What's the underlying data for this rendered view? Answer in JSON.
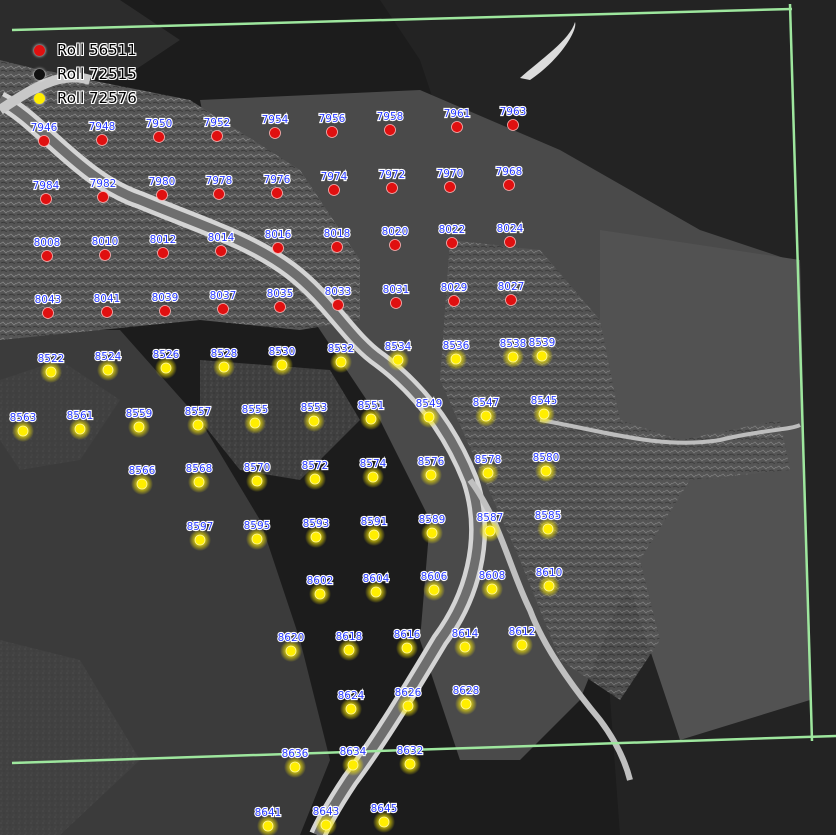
{
  "legend": [
    {
      "label": "Roll 56511",
      "color": "#e01010"
    },
    {
      "label": "Roll 72515",
      "color": "#111111"
    },
    {
      "label": "Roll 72576",
      "color": "#ffee00"
    }
  ],
  "colors": {
    "boundary": "#9ee79e",
    "label_text": "#2a3cff",
    "red_point": "#e01010",
    "yellow_point": "#ffee00"
  },
  "points": {
    "red": [
      "7946",
      "7948",
      "7950",
      "7952",
      "7954",
      "7956",
      "7958",
      "7961",
      "7963",
      "7984",
      "7982",
      "7980",
      "7978",
      "7976",
      "7974",
      "7972",
      "7970",
      "7968",
      "8008",
      "8010",
      "8012",
      "8014",
      "8016",
      "8018",
      "8020",
      "8022",
      "8024",
      "8043",
      "8041",
      "8039",
      "8037",
      "8035",
      "8033",
      "8031",
      "8029",
      "8027"
    ],
    "yellow": [
      "8522",
      "8524",
      "8526",
      "8528",
      "8530",
      "8532",
      "8534",
      "8536",
      "8538",
      "8539",
      "8563",
      "8561",
      "8559",
      "8557",
      "8555",
      "8553",
      "8551",
      "8549",
      "8547",
      "8545",
      "8566",
      "8568",
      "8570",
      "8572",
      "8574",
      "8576",
      "8578",
      "8580",
      "8597",
      "8595",
      "8593",
      "8591",
      "8589",
      "8587",
      "8585",
      "8602",
      "8604",
      "8606",
      "8608",
      "8610",
      "8620",
      "8618",
      "8616",
      "8614",
      "8612",
      "8624",
      "8626",
      "8628",
      "8636",
      "8634",
      "8632",
      "8641",
      "8643",
      "8645"
    ]
  }
}
